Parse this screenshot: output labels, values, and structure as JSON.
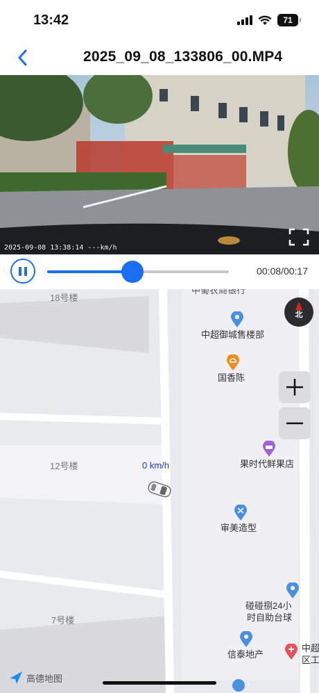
{
  "status_bar": {
    "time": "13:42",
    "battery": "71",
    "icons": [
      "signal-icon",
      "wifi-icon",
      "battery-icon"
    ]
  },
  "nav": {
    "back_icon": "chevron-left-icon",
    "title": "2025_09_08_133806_00.MP4"
  },
  "video": {
    "overlay_text": "2025-09-08 13:38:14 ---km/h",
    "fullscreen_icon": "fullscreen-icon"
  },
  "playback": {
    "state": "playing",
    "progress": 0.47,
    "time_readout": "00:08/00:17",
    "accent": "#1a6ef0"
  },
  "map": {
    "buildings": [
      "18号楼",
      "12号楼",
      "7号楼"
    ],
    "pois": [
      {
        "label": "中超御城售楼部",
        "icon": "location-pin-icon",
        "color": "#4a90e2"
      },
      {
        "label": "国香陈",
        "icon": "restaurant-icon",
        "color": "#f08a1c"
      },
      {
        "label": "果时代鲜果店",
        "icon": "shop-basket-icon",
        "color": "#a060d8"
      },
      {
        "label": "审美造型",
        "icon": "scissors-icon",
        "color": "#4a90e2"
      },
      {
        "label": "碰碰捌24小",
        "icon": "location-pin-icon",
        "color": "#4a90e2"
      },
      {
        "label": "时自助台球",
        "icon": "",
        "color": "#4a90e2"
      },
      {
        "label": "信泰地产",
        "icon": "location-pin-icon",
        "color": "#4a90e2"
      },
      {
        "label": "中超",
        "icon": "medical-icon",
        "color": "#e8505b"
      },
      {
        "label": "区工",
        "icon": "",
        "color": "#e8505b"
      }
    ],
    "top_cut_label": "中蜀农商银行",
    "compass_label": "北",
    "zoom_in": "+",
    "zoom_out": "−",
    "speed": "0 km/h",
    "logo_text": "高德地图"
  }
}
